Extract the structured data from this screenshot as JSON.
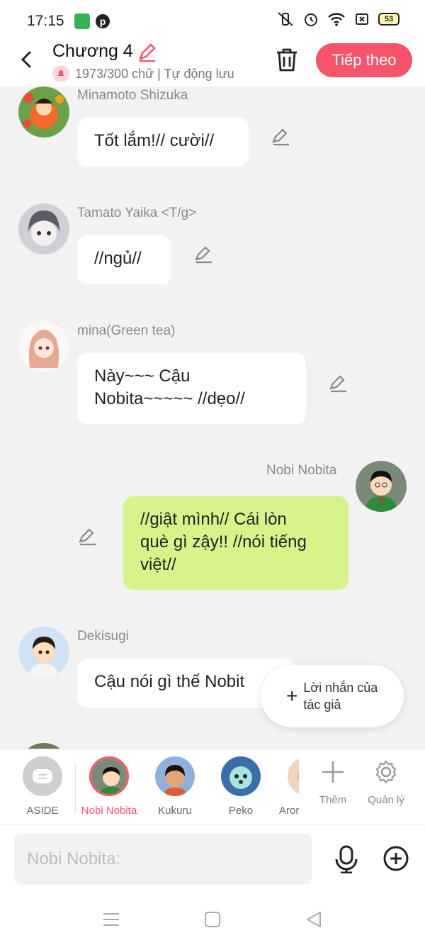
{
  "status_bar": {
    "time": "17:15",
    "battery": "53"
  },
  "header": {
    "title": "Chương 4",
    "subtitle": "1973/300 chữ | Tự động lưu",
    "next_label": "Tiếp theo"
  },
  "messages": [
    {
      "sender": "Minamoto Shizuka",
      "text": "Tốt lắm!// cười//",
      "side": "left"
    },
    {
      "sender": "Tamato Yaika <T/g>",
      "text": "//ngủ//",
      "side": "left"
    },
    {
      "sender": "mina(Green tea)",
      "lines": [
        "Này~~~ Cậu",
        "Nobita~~~~~ //dẹo//"
      ],
      "side": "left"
    },
    {
      "sender": "Nobi Nobita",
      "lines": [
        "//giật mình// Cái lòn",
        "què gì zậy!! //nói tiếng",
        "việt//"
      ],
      "side": "right"
    },
    {
      "sender": "Dekisugi",
      "text": "Cậu nói gì thế Nobit",
      "side": "left"
    }
  ],
  "author_note": {
    "label": "Lời nhắn của tác giả"
  },
  "characters": [
    {
      "name": "ASIDE"
    },
    {
      "name": "Nobi Nobita",
      "active": true
    },
    {
      "name": "Kukuru"
    },
    {
      "name": "Peko"
    },
    {
      "name": "Aron"
    }
  ],
  "tools": {
    "add_label": "Thêm",
    "manage_label": "Quản lý"
  },
  "input": {
    "placeholder": "Nobi Nobita:"
  },
  "colors": {
    "accent": "#f6546a",
    "my_bubble": "#d6f48a",
    "background": "#f2f2f2"
  }
}
